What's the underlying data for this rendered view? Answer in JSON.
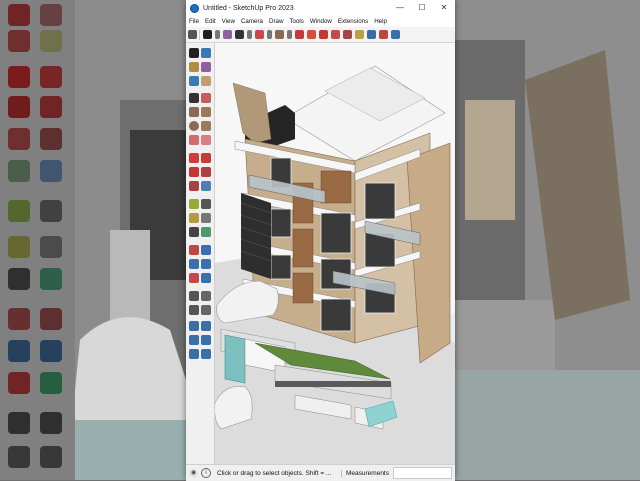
{
  "window": {
    "title": "Untitled - SketchUp Pro 2023",
    "controls": {
      "minimize": "—",
      "maximize": "☐",
      "close": "✕"
    }
  },
  "menu": [
    "File",
    "Edit",
    "View",
    "Camera",
    "Draw",
    "Tools",
    "Window",
    "Extensions",
    "Help"
  ],
  "status": {
    "hint": "Click or drag to select objects. Shift = ...",
    "measurements_label": "Measurements",
    "info_icon": "i"
  },
  "colors": {
    "facade_beige": "#c6ad8c",
    "facade_wood": "#9a6a45",
    "window_dark": "#3a3a3a",
    "lawn_green": "#5f8a3c",
    "slab_white": "#f4f4f4",
    "ui_blue": "#1e6fc2"
  }
}
